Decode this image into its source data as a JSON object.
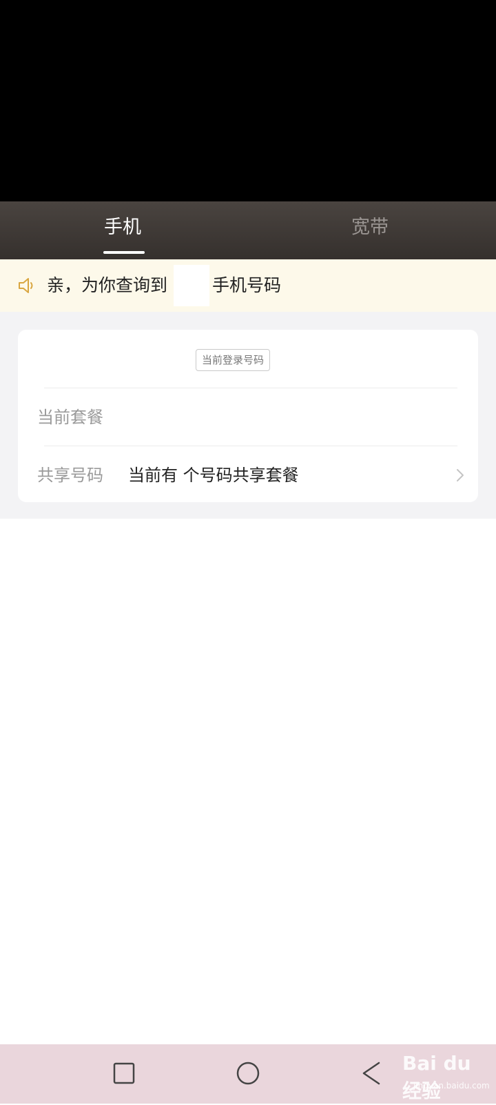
{
  "tabs": {
    "phone_label": "手机",
    "broadband_label": "宽带"
  },
  "notice": {
    "text_before": "亲，为你查询到",
    "text_after": "手机号码"
  },
  "card": {
    "login_badge": "当前登录号码",
    "plan_label": "当前套餐",
    "share_label": "共享号码",
    "share_value": "当前有 个号码共享套餐"
  },
  "watermark": {
    "title": "Bai du 经验",
    "subtitle": "jingyan.baidu.com"
  },
  "colors": {
    "tabbar_bg": "#3b3633",
    "notice_bg": "#fdf9ea",
    "speaker_icon": "#d9a640",
    "navbar_bg": "#ead6dc"
  }
}
